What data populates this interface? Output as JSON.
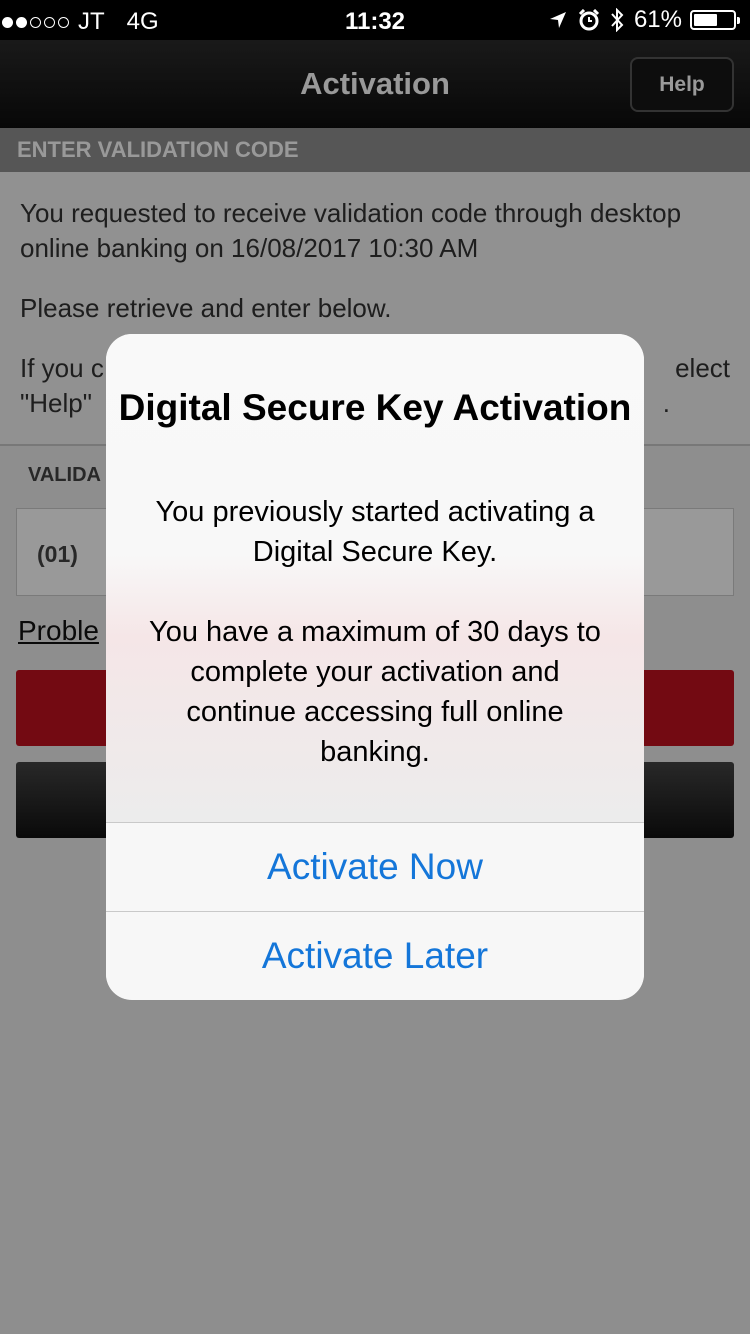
{
  "status_bar": {
    "carrier": "JT",
    "network": "4G",
    "time": "11:32",
    "battery": "61%",
    "battery_level": 0.61,
    "icons": [
      "location-arrow-icon",
      "alarm-clock-icon",
      "bluetooth-icon"
    ]
  },
  "nav": {
    "title": "Activation",
    "help_label": "Help"
  },
  "section": {
    "header": "ENTER VALIDATION CODE",
    "para1": "You requested to receive validation code through desktop online banking on 16/08/2017 10:30 AM",
    "para2": "Please retrieve and enter below.",
    "para3_start": "If you c",
    "para3_end": "elect",
    "para4_start": "\"Help\"",
    "para4_end": "."
  },
  "validation": {
    "label": "VALIDA",
    "prefix": "(01)"
  },
  "problem_link": "Proble",
  "alert": {
    "title": "Digital Secure Key Activation",
    "message1": "You previously started activating a Digital Secure Key.",
    "message2": "You have a maximum of 30 days to complete your activation and continue accessing full online banking.",
    "activate_now": "Activate Now",
    "activate_later": "Activate Later"
  },
  "colors": {
    "accent_blue": "#1476d9",
    "brand_red": "#c0121f"
  }
}
